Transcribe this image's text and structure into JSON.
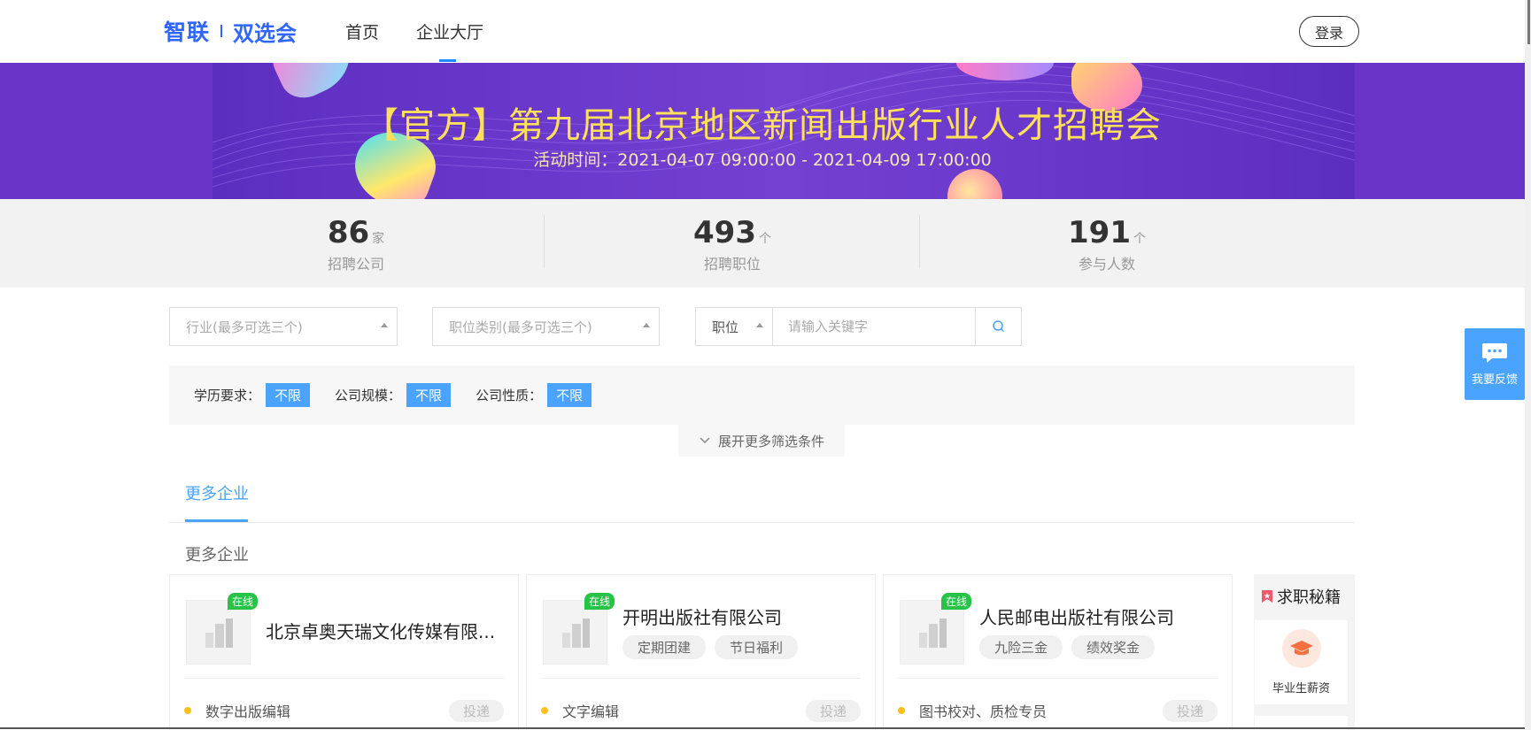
{
  "header": {
    "logo_brand": "智联",
    "logo_product": "双选会",
    "nav": [
      {
        "label": "首页"
      },
      {
        "label": "企业大厅"
      }
    ],
    "login_label": "登录"
  },
  "banner": {
    "title": "【官方】第九届北京地区新闻出版行业人才招聘会",
    "time": "活动时间：2021-04-07 09:00:00 - 2021-04-09 17:00:00"
  },
  "stats": [
    {
      "value": "86",
      "unit": "家",
      "label": "招聘公司"
    },
    {
      "value": "493",
      "unit": "个",
      "label": "招聘职位"
    },
    {
      "value": "191",
      "unit": "个",
      "label": "参与人数"
    }
  ],
  "filters": {
    "industry_placeholder": "行业(最多可选三个)",
    "category_placeholder": "职位类别(最多可选三个)",
    "search_type": "职位",
    "search_placeholder": "请输入关键字",
    "conditions": [
      {
        "label": "学历要求：",
        "value": "不限"
      },
      {
        "label": "公司规模：",
        "value": "不限"
      },
      {
        "label": "公司性质：",
        "value": "不限"
      }
    ],
    "expand_label": "展开更多筛选条件"
  },
  "tabs": {
    "active": "更多企业"
  },
  "section_title": "更多企业",
  "companies": [
    {
      "name": "北京卓奥天瑞文化传媒有限...",
      "online": "在线",
      "tags": [],
      "job": "数字出版编辑",
      "apply": "投递"
    },
    {
      "name": "开明出版社有限公司",
      "online": "在线",
      "tags": [
        "定期团建",
        "节日福利"
      ],
      "job": "文字编辑",
      "apply": "投递"
    },
    {
      "name": "人民邮电出版社有限公司",
      "online": "在线",
      "tags": [
        "九险三金",
        "绩效奖金"
      ],
      "job": "图书校对、质检专员",
      "apply": "投递"
    }
  ],
  "side_panel": {
    "title": "求职秘籍",
    "item_label": "毕业生薪资"
  },
  "feedback_label": "我要反馈",
  "colors": {
    "brand_blue": "#2f66ff",
    "accent_blue": "#4aa3ff",
    "banner_purple": "#6b34c8",
    "banner_title": "#ffe05a",
    "online_green": "#26c346",
    "dot_yellow": "#ffc019"
  }
}
